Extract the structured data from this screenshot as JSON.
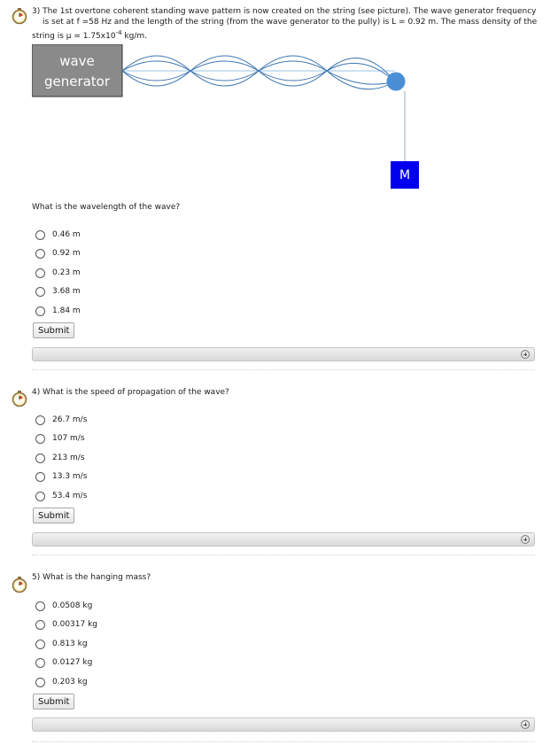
{
  "q3": {
    "line1": "3) The 1st overtone coherent standing wave pattern is now created on the string (see picture). The wave generator frequency",
    "line2": "is set at f =58 Hz and the length of the string (from the wave generator to the pully) is L = 0.92 m. The mass density of the",
    "line3_pre": "string is μ = 1.75x10",
    "line3_exp": "-4",
    "line3_post": " kg/m.",
    "diagram": {
      "generator_line1": "wave",
      "generator_line2": "generator",
      "mass_label": "M",
      "generator_color": "#8a8a8a",
      "string_color": "#3d74b0",
      "pulley_color": "#4a8fd6",
      "mass_color": "#0000ee"
    },
    "prompt": "What is the wavelength of the wave?",
    "options": [
      "0.46 m",
      "0.92 m",
      "0.23 m",
      "3.68 m",
      "1.84 m"
    ],
    "submit_label": "Submit"
  },
  "q4": {
    "prompt": "4) What is the speed of propagation of the wave?",
    "options": [
      "26.7 m/s",
      "107 m/s",
      "213 m/s",
      "13.3 m/s",
      "53.4 m/s"
    ],
    "submit_label": "Submit"
  },
  "q5": {
    "prompt": "5) What is the hanging mass?",
    "options": [
      "0.0508 kg",
      "0.00317 kg",
      "0.813 kg",
      "0.0127 kg",
      "0.203 kg"
    ],
    "submit_label": "Submit"
  },
  "icons": {
    "timer": "stopwatch-icon",
    "expand": "plus-circle-icon"
  }
}
